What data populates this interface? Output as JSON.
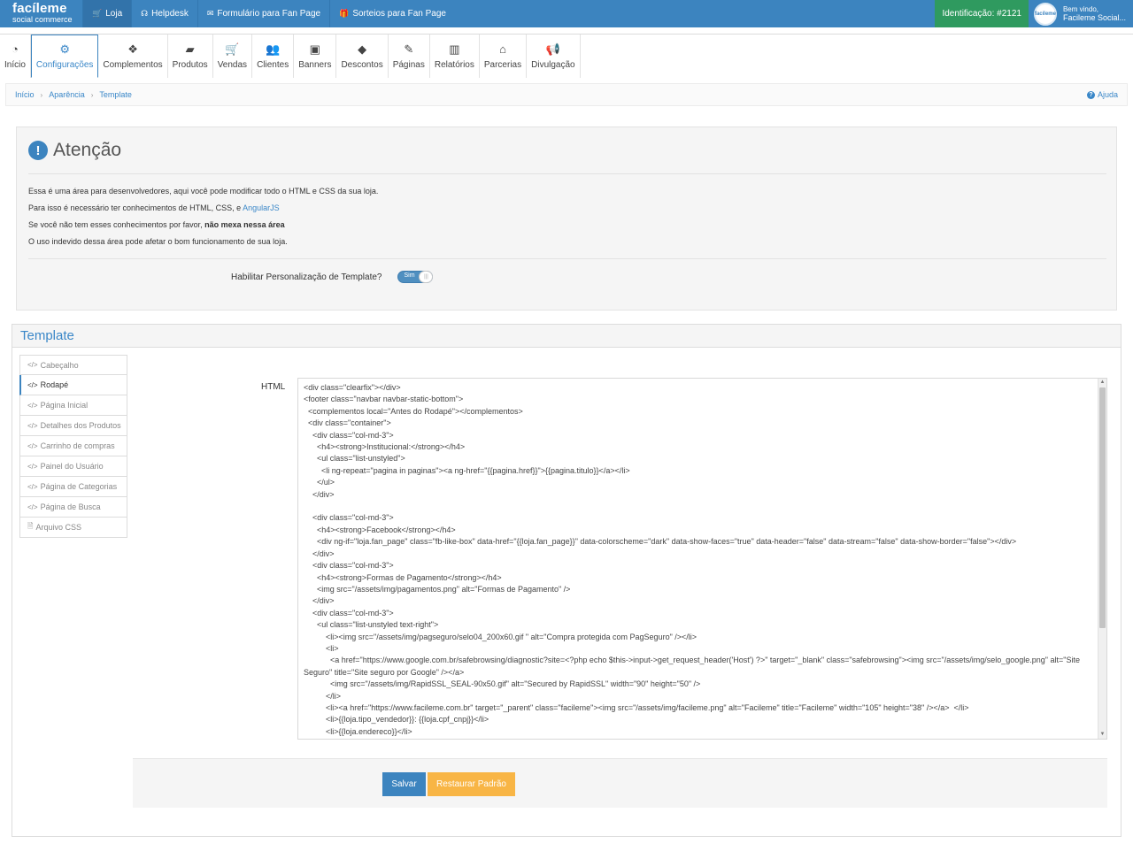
{
  "brand": {
    "name": "facíleme",
    "tagline": "social commerce"
  },
  "topnav": [
    {
      "label": "Loja",
      "icon": "cart-icon",
      "glyph": "🛒"
    },
    {
      "label": "Helpdesk",
      "icon": "headset-icon",
      "glyph": "☊"
    },
    {
      "label": "Formulário para Fan Page",
      "icon": "envelope-icon",
      "glyph": "✉"
    },
    {
      "label": "Sorteios para Fan Page",
      "icon": "gift-icon",
      "glyph": "🎁"
    }
  ],
  "user": {
    "identification": "Identificação: #2121",
    "avatar_text": "facíleme",
    "welcome": "Bem vindo,",
    "name": "Facileme Social..."
  },
  "modnav": [
    {
      "label": "Início",
      "glyph": "◔",
      "icon": "dashboard-icon"
    },
    {
      "label": "Configurações",
      "glyph": "⚙",
      "icon": "cogs-icon"
    },
    {
      "label": "Complementos",
      "glyph": "❖",
      "icon": "cubes-icon"
    },
    {
      "label": "Produtos",
      "glyph": "▰",
      "icon": "folder-icon"
    },
    {
      "label": "Vendas",
      "glyph": "🛒",
      "icon": "cart-icon"
    },
    {
      "label": "Clientes",
      "glyph": "👥",
      "icon": "users-icon"
    },
    {
      "label": "Banners",
      "glyph": "▣",
      "icon": "image-icon"
    },
    {
      "label": "Descontos",
      "glyph": "◆",
      "icon": "tags-icon"
    },
    {
      "label": "Páginas",
      "glyph": "✎",
      "icon": "edit-icon"
    },
    {
      "label": "Relatórios",
      "glyph": "▥",
      "icon": "bar-chart-icon"
    },
    {
      "label": "Parcerias",
      "glyph": "⌂",
      "icon": "institution-icon"
    },
    {
      "label": "Divulgação",
      "glyph": "📢",
      "icon": "bullhorn-icon"
    }
  ],
  "breadcrumb": [
    "Início",
    "Aparência",
    "Template"
  ],
  "help": "Ajuda",
  "attention": {
    "title": "Atenção",
    "line1": "Essa é uma área para desenvolvedores, aqui você pode modificar todo o HTML e CSS da sua loja.",
    "line2_prefix": "Para isso é necessário ter conhecimentos de HTML, CSS, e ",
    "line2_link": "AngularJS",
    "line3_prefix": "Se você não tem esses conhecimentos por favor, ",
    "line3_bold": "não mexa nessa área",
    "line4": "O uso indevido dessa área pode afetar o bom funcionamento de sua loja.",
    "toggle_label": "Habilitar Personalização de Template?",
    "toggle_value": "Sim"
  },
  "template": {
    "title": "Template",
    "tabs": [
      {
        "label": "Cabeçalho",
        "glyph": "</>"
      },
      {
        "label": "Rodapé",
        "glyph": "</>"
      },
      {
        "label": "Página Inicial",
        "glyph": "</>"
      },
      {
        "label": "Detalhes dos Produtos",
        "glyph": "</>"
      },
      {
        "label": "Carrinho de compras",
        "glyph": "</>"
      },
      {
        "label": "Painel do Usuário",
        "glyph": "</>"
      },
      {
        "label": "Página de Categorias",
        "glyph": "</>"
      },
      {
        "label": "Página de Busca",
        "glyph": "</>"
      },
      {
        "label": "Arquivo CSS",
        "glyph": "🗎"
      }
    ],
    "html_label": "HTML",
    "code": "<div class=\"clearfix\"></div>\n<footer class=\"navbar navbar-static-bottom\">\n  <complementos local=\"Antes do Rodapé\"></complementos>\n  <div class=\"container\">\n    <div class=\"col-md-3\">\n      <h4><strong>Institucional:</strong></h4>\n      <ul class=\"list-unstyled\">\n        <li ng-repeat=\"pagina in paginas\"><a ng-href=\"{{pagina.href}}\">{{pagina.titulo}}</a></li>\n      </ul>\n    </div>\n\n    <div class=\"col-md-3\">\n      <h4><strong>Facebook</strong></h4>\n      <div ng-if=\"loja.fan_page\" class=\"fb-like-box\" data-href=\"{{loja.fan_page}}\" data-colorscheme=\"dark\" data-show-faces=\"true\" data-header=\"false\" data-stream=\"false\" data-show-border=\"false\"></div>\n    </div>\n    <div class=\"col-md-3\">\n      <h4><strong>Formas de Pagamento</strong></h4>\n      <img src=\"/assets/img/pagamentos.png\" alt=\"Formas de Pagamento\" />\n    </div>\n    <div class=\"col-md-3\">\n      <ul class=\"list-unstyled text-right\">\n          <li><img src=\"/assets/img/pagseguro/selo04_200x60.gif \" alt=\"Compra protegida com PagSeguro\" /></li>\n          <li>\n            <a href=\"https://www.google.com.br/safebrowsing/diagnostic?site=<?php echo $this->input->get_request_header('Host') ?>\" target=\"_blank\" class=\"safebrowsing\"><img src=\"/assets/img/selo_google.png\" alt=\"Site Seguro\" title=\"Site seguro por Google\" /></a>\n            <img src=\"/assets/img/RapidSSL_SEAL-90x50.gif\" alt=\"Secured by RapidSSL\" width=\"90\" height=\"50\" />\n          </li>\n          <li><a href=\"https://www.facileme.com.br\" target=\"_parent\" class=\"facileme\"><img src=\"/assets/img/facileme.png\" alt=\"Facileme\" title=\"Facileme\" width=\"105\" height=\"38\" /></a>  </li>\n          <li>{{loja.tipo_vendedor}}: {{loja.cpf_cnpj}}</li>\n          <li>{{loja.endereco}}</li>",
    "save": "Salvar",
    "restore": "Restaurar Padrão"
  }
}
